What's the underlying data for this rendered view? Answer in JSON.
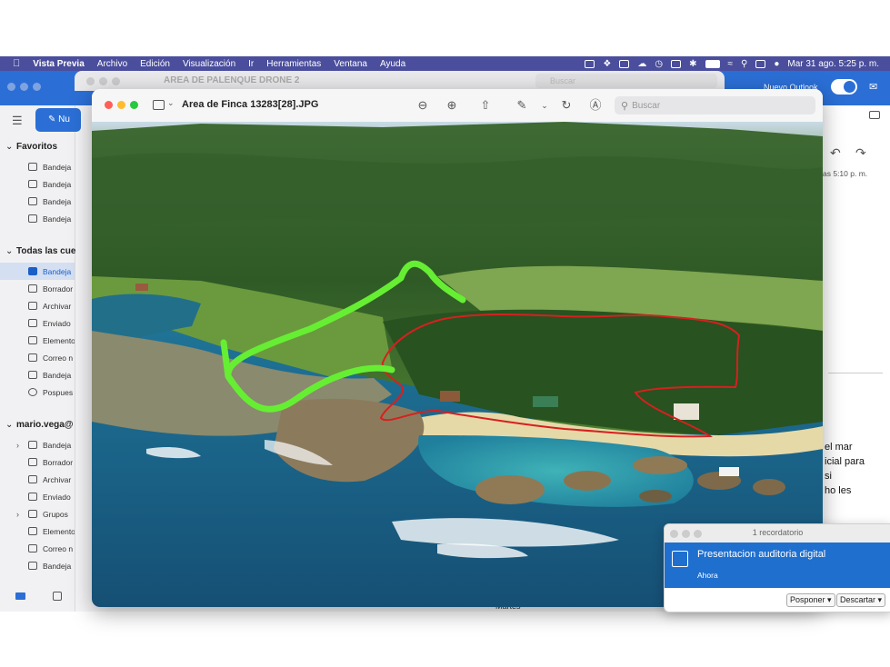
{
  "menubar": {
    "app": "Vista Previa",
    "items": [
      "Archivo",
      "Edición",
      "Visualización",
      "Ir",
      "Herramientas",
      "Ventana",
      "Ayuda"
    ],
    "clock": "Mar 31 ago.  5:25 p. m."
  },
  "outlook": {
    "new_outlook": "Nuevo Outlook",
    "new_button": "Nu",
    "favorites_title": "Favoritos",
    "favorites": [
      "Bandeja",
      "Bandeja",
      "Bandeja",
      "Bandeja"
    ],
    "all_accounts_title": "Todas las cue",
    "all_accounts": [
      "Bandeja",
      "Borrador",
      "Archivar",
      "Enviado",
      "Elemento",
      "Correo n",
      "Bandeja",
      "Pospues"
    ],
    "account_title": "mario.vega@",
    "account_items": [
      "Bandeja",
      "Borrador",
      "Archivar",
      "Enviado",
      "Grupos",
      "Elemento",
      "Correo n",
      "Bandeja"
    ],
    "reading_time": "as 5:10 p. m.",
    "reading_text": [
      "el mar",
      "icial para",
      "si",
      "ho les"
    ],
    "bottom_text": "Martes"
  },
  "back_preview": {
    "title": "AREA DE PALENQUE DRONE 2",
    "search_placeholder": "Buscar"
  },
  "preview": {
    "title": "Area de Finca 13283[28].JPG",
    "search_placeholder": "Buscar"
  },
  "reminder": {
    "count": "1 recordatorio",
    "title": "Presentacion auditoria digital",
    "time": "Ahora",
    "snooze": "Posponer",
    "dismiss": "Descartar"
  },
  "colors": {
    "menubar": "#4a4e9c",
    "outlook_accent": "#2b6fd6",
    "reminder_accent": "#1f6fce",
    "annotation_green": "#66ee33",
    "annotation_red": "#d62020"
  }
}
